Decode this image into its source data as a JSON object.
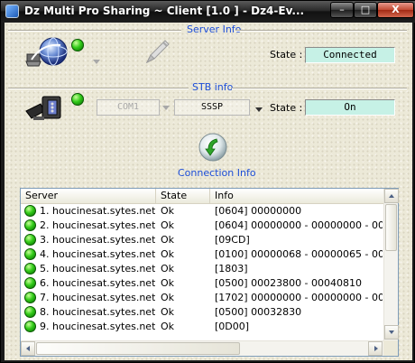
{
  "window": {
    "title": "Dz Multi Pro Sharing ~ Client [1.0 ] - Dz4-Ev...",
    "min_label": "–",
    "max_label": "□",
    "close_label": "X"
  },
  "server_info": {
    "title": "Server Info",
    "state_label": "State :",
    "state_value": "Connected",
    "status_color": "#33cc1a"
  },
  "stb_info": {
    "title": "STB info",
    "port_value": "COM1",
    "protocol_value": "SSSP",
    "state_label": "State :",
    "state_value": "On",
    "status_color": "#33cc1a"
  },
  "connection_info": {
    "title": "Connection Info",
    "icon": "green-refresh-icon"
  },
  "list": {
    "columns": [
      "Server",
      "State",
      "Info"
    ],
    "rows": [
      {
        "server": "1. houcinesat.sytes.net [...",
        "state": "Ok",
        "info": "[0604] 00000000"
      },
      {
        "server": "2. houcinesat.sytes.net [...",
        "state": "Ok",
        "info": "[0604] 00000000 - 00000000 - 00000..."
      },
      {
        "server": "3. houcinesat.sytes.net [...",
        "state": "Ok",
        "info": "[09CD]"
      },
      {
        "server": "4. houcinesat.sytes.net [...",
        "state": "Ok",
        "info": "[0100] 00000068 - 00000065 - 00000..."
      },
      {
        "server": "5. houcinesat.sytes.net [...",
        "state": "Ok",
        "info": "[1803]"
      },
      {
        "server": "6. houcinesat.sytes.net [...",
        "state": "Ok",
        "info": "[0500] 00023800 - 00040810"
      },
      {
        "server": "7. houcinesat.sytes.net [...",
        "state": "Ok",
        "info": "[1702] 00000000 - 00000000 - 00000..."
      },
      {
        "server": "8. houcinesat.sytes.net [...",
        "state": "Ok",
        "info": "[0500] 00032830"
      },
      {
        "server": "9. houcinesat.sytes.net [...",
        "state": "Ok",
        "info": "[0D00]"
      }
    ]
  },
  "colors": {
    "group_title": "#1d4ed8",
    "state_box": "#c6f1e6",
    "led_green": "#33cc1a"
  }
}
